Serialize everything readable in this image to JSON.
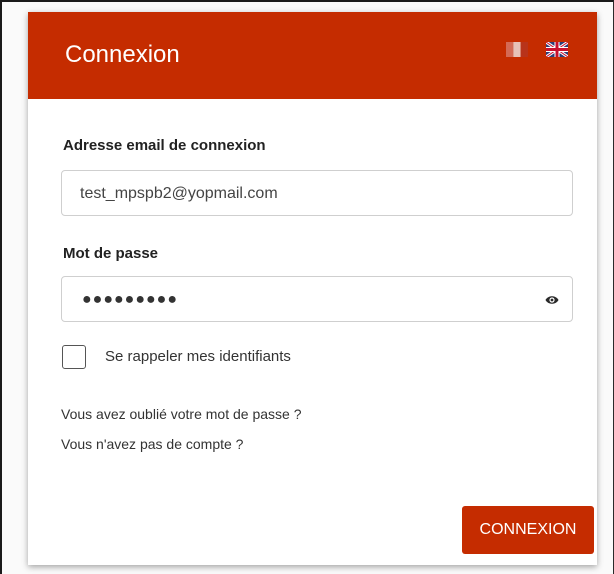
{
  "header": {
    "title": "Connexion",
    "background_color": "#c52c00",
    "language_flags": [
      {
        "icon": "french-flag-icon"
      },
      {
        "icon": "uk-flag-icon"
      }
    ]
  },
  "form": {
    "email": {
      "label": "Adresse email de connexion",
      "value": "test_mpspb2@yopmail.com"
    },
    "password": {
      "label": "Mot de passe",
      "masked_value": "●●●●●●●●●",
      "toggle_icon": "eye-icon"
    },
    "remember": {
      "label": "Se rappeler mes identifiants",
      "checked": false
    },
    "links": {
      "forgot_password": "Vous avez oublié votre mot de passe ?",
      "no_account": "Vous n'avez pas de compte ?"
    },
    "submit_label": "CONNEXION"
  }
}
